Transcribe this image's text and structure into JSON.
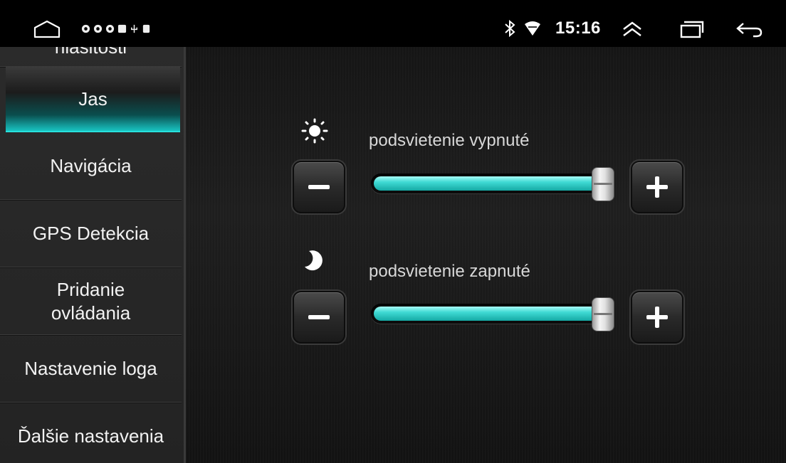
{
  "status_bar": {
    "time": "15:16",
    "icons": [
      "home-icon",
      "notification-icon",
      "usb-icon",
      "bluetooth-icon",
      "wifi-icon",
      "chevron-up-icon",
      "recent-apps-icon",
      "back-icon"
    ]
  },
  "sidebar": {
    "items": [
      {
        "label": "hlasitosti",
        "active": false
      },
      {
        "label": "Jas",
        "active": true
      },
      {
        "label": "Navigácia",
        "active": false
      },
      {
        "label": "GPS Detekcia",
        "active": false
      },
      {
        "label": "Pridanie ovládania",
        "active": false
      },
      {
        "label": "Nastavenie loga",
        "active": false
      },
      {
        "label": "Ďalšie nastavenia",
        "active": false
      }
    ]
  },
  "brightness": {
    "day": {
      "icon": "sun-icon",
      "label": "podsvietenie vypnuté",
      "value_fraction": 1.0
    },
    "night": {
      "icon": "moon-icon",
      "label": "podsvietenie zapnuté",
      "value_fraction": 1.0
    }
  },
  "colors": {
    "accent": "#2fd3cf"
  }
}
